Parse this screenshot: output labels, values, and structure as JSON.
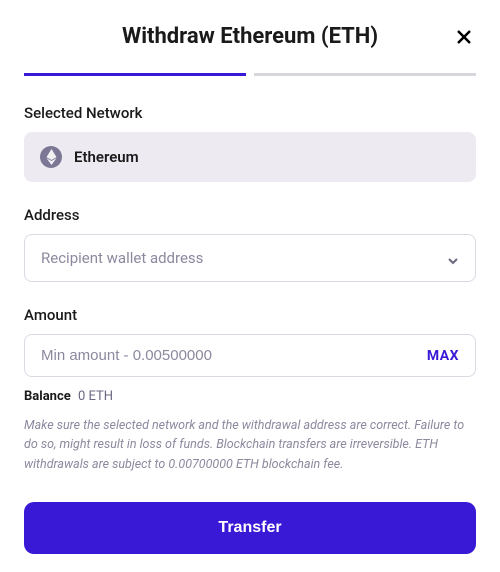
{
  "header": {
    "title": "Withdraw Ethereum (ETH)"
  },
  "network": {
    "label": "Selected Network",
    "name": "Ethereum"
  },
  "address": {
    "label": "Address",
    "placeholder": "Recipient wallet address"
  },
  "amount": {
    "label": "Amount",
    "placeholder": "Min amount - 0.00500000",
    "max_label": "MAX"
  },
  "balance": {
    "label": "Balance",
    "value": "0 ETH"
  },
  "disclaimer": "Make sure the selected network and the withdrawal address are correct. Failure to do so, might result in loss of funds. Blockchain transfers are irreversible. ETH withdrawals are subject to 0.00700000 ETH blockchain fee.",
  "actions": {
    "transfer": "Transfer"
  },
  "colors": {
    "accent": "#3a19d6"
  }
}
